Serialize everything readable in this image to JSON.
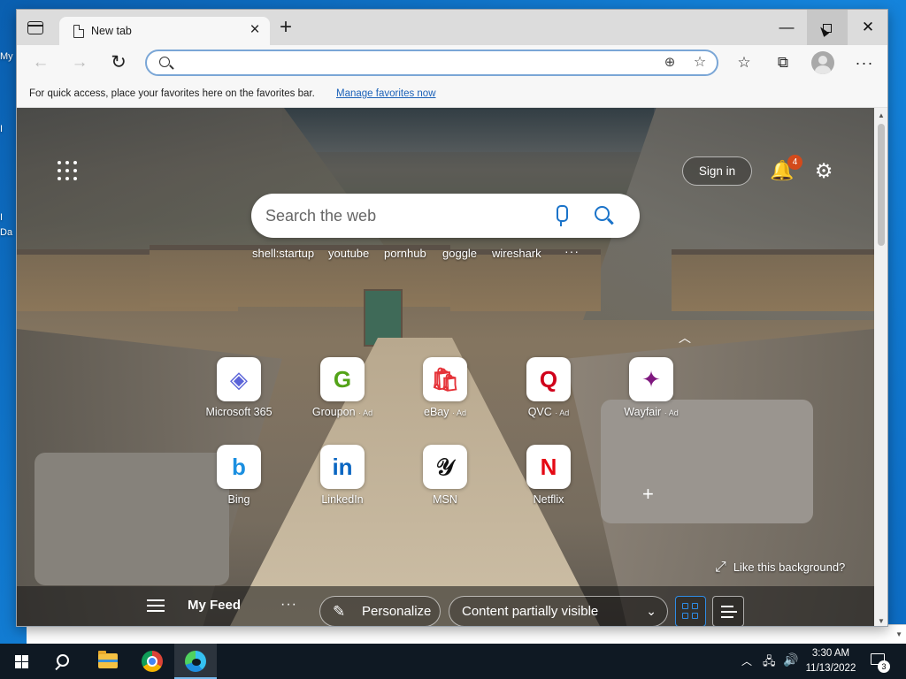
{
  "desktop": {
    "edge_labels": [
      "My",
      "I",
      "I",
      "Da"
    ]
  },
  "browser": {
    "tab": {
      "title": "New tab",
      "close": "×"
    },
    "new_tab": "+",
    "window_controls": {
      "minimize": "—",
      "close": "✕"
    },
    "toolbar": {
      "back": "←",
      "forward": "→",
      "refresh": "↻",
      "address": {
        "value": "",
        "placeholder": ""
      },
      "zoom": "⊕",
      "add_favorite": "☆",
      "favorites": "☆",
      "collections": "⧉",
      "more": "···"
    },
    "favorites_bar": {
      "message": "For quick access, place your favorites here on the favorites bar.",
      "link": "Manage favorites now"
    }
  },
  "newtab": {
    "sign_in": "Sign in",
    "notification_count": "4",
    "bell": "🔔",
    "settings": "⚙",
    "search": {
      "placeholder": "Search the web"
    },
    "quick_searches": [
      "shell:startup",
      "youtube",
      "pornhub",
      "goggle",
      "wireshark"
    ],
    "quick_more": "···",
    "collapse": "︿",
    "quick_links": [
      {
        "name": "Microsoft 365",
        "ad": "",
        "glyph": "◈",
        "color": "#5a63d8"
      },
      {
        "name": "Groupon",
        "ad": "· Ad",
        "glyph": "G",
        "color": "#53a318"
      },
      {
        "name": "eBay",
        "ad": "· Ad",
        "glyph": "🛍",
        "color": "#e53238"
      },
      {
        "name": "QVC",
        "ad": "· Ad",
        "glyph": "Q",
        "color": "#d0021b"
      },
      {
        "name": "Wayfair",
        "ad": "· Ad",
        "glyph": "✦",
        "color": "#7f187f"
      },
      {
        "name": "Bing",
        "ad": "",
        "glyph": "b",
        "color": "#1b8fe0"
      },
      {
        "name": "LinkedIn",
        "ad": "",
        "glyph": "in",
        "color": "#0a66c2"
      },
      {
        "name": "MSN",
        "ad": "",
        "glyph": "𝒴",
        "color": "#111111"
      },
      {
        "name": "Netflix",
        "ad": "",
        "glyph": "N",
        "color": "#e50914"
      }
    ],
    "like_background": "Like this background?",
    "like_icon": "⤢",
    "feed": {
      "title": "My Feed",
      "more": "···",
      "personalize": "Personalize",
      "personalize_icon": "✎",
      "visibility": "Content partially visible",
      "visibility_icon": "⌄"
    }
  },
  "taskbar": {
    "tray_chevron": "︿",
    "network": "🖧",
    "volume": "🔊",
    "time": "3:30 AM",
    "date": "11/13/2022",
    "notification_count": "3"
  }
}
